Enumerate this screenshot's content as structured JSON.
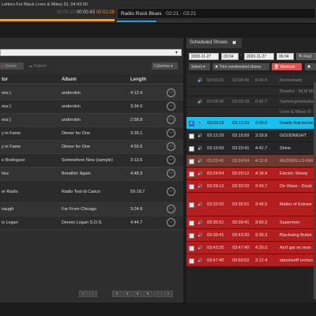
{
  "top": {
    "now_playing": "Letters For Black Lives & Mikey D), 04:43:00",
    "time_elapsed": "00:03:10",
    "time_now": "00:00:43",
    "time_remain": "00:02:26",
    "next_show": "Radio Rock Blues",
    "next_show_time": "02:21 - 03:21",
    "left_progress": 1.0,
    "right_progress": 0.2,
    "colors": {
      "orange": "#f08a24",
      "blue": "#1ea0e0"
    }
  },
  "library": {
    "delete_label": "Delete",
    "publish_label": "Publish",
    "columns_label": "Columns",
    "headers": {
      "creator": "tor",
      "album": "Album",
      "length": "Length"
    },
    "rows": [
      {
        "creator": "ess:)",
        "album": "underskin",
        "length": "4:12.4"
      },
      {
        "creator": "ess:)",
        "album": "underskin",
        "length": "3:34.0"
      },
      {
        "creator": "ess:)",
        "album": "underskin",
        "length": "2:58.8"
      },
      {
        "creator": "y in Fame",
        "album": "Dinner for One",
        "length": "3:39.1"
      },
      {
        "creator": "y in Fame",
        "album": "Dinner for One",
        "length": "4:59.6"
      },
      {
        "creator": "e Rodeguez",
        "album": "Somewhere New (sample)",
        "length": "3:13.6"
      },
      {
        "creator": "hes",
        "album": "Breathin' Again",
        "length": "4:48.3"
      },
      {
        "creator": "er Radio",
        "album": "Radio Test di Carico",
        "length": "59:18.7"
      },
      {
        "creator": "naugh",
        "album": "Far From Chicago",
        "length": "3:24.8"
      },
      {
        "creator": "is Logan",
        "album": "Dennis Logan S.O.S.",
        "length": "4:44.7"
      }
    ],
    "pager": [
      "«",
      "‹",
      "2",
      "3",
      "4",
      "5",
      "›",
      "»"
    ]
  },
  "scheduled": {
    "tab_label": "Scheduled Shows",
    "date_from": "2020-11-27",
    "time_from": "03:04",
    "date_to": "2020-11-27",
    "time_to": "06:04",
    "find_label": "Find",
    "select_label": "Select",
    "trim_label": "Trim overbooked shows",
    "remove_label": "Remove",
    "rows": [
      {
        "start": "03:00:31",
        "end": "03:04:36",
        "len": "0:04:4",
        "title": "Rocksteady",
        "style": "past",
        "checked": false,
        "cb": false
      },
      {
        "start": "",
        "end": "",
        "len": "",
        "title": "Breathe - BLM Mi",
        "style": "past",
        "checked": false,
        "cb": false
      },
      {
        "start": "03:04:36",
        "end": "03:09:18",
        "len": "0:42.7",
        "title": "Spinningmerkaba",
        "style": "past",
        "checked": false,
        "cb": false
      },
      {
        "start": "",
        "end": "",
        "len": "",
        "title": "Lives & Mikey D",
        "style": "past",
        "checked": false,
        "cb": false
      },
      {
        "start": "03:09:19",
        "end": "03:12:29",
        "len": "3:09.6",
        "title": "Roads that burne",
        "style": "current",
        "checked": true,
        "cb": true
      },
      {
        "start": "03:12:29",
        "end": "03:15:59",
        "len": "3:29.8",
        "title": "GOODNIGHT",
        "style": "normal",
        "checked": false,
        "cb": true
      },
      {
        "start": "03:15:59",
        "end": "03:20:41",
        "len": "4:42.7",
        "title": "Shine",
        "style": "normal",
        "checked": false,
        "cb": true
      },
      {
        "start": "03:20:41",
        "end": "03:24:54",
        "len": "4:12.8",
        "title": "MUDSKILLS-RAI",
        "style": "overbook-dark",
        "checked": false,
        "cb": true
      },
      {
        "start": "03:24:54",
        "end": "03:29:12",
        "len": "4:18.4",
        "title": "Electric Sheep",
        "style": "overbook",
        "checked": false,
        "cb": true
      },
      {
        "start": "03:29:12",
        "end": "03:32:02",
        "len": "2:49.7",
        "title": "On Wave - Doub",
        "style": "overbook",
        "checked": false,
        "cb": true
      },
      {
        "start": "03:32:02",
        "end": "03:35:51",
        "len": "3:48.5",
        "title": "Matter of Extraor",
        "style": "overbook",
        "checked": false,
        "cb": true
      },
      {
        "start": "03:35:51",
        "end": "03:39:41",
        "len": "3:50.3",
        "title": "Supermen",
        "style": "overbook",
        "checked": false,
        "cb": true
      },
      {
        "start": "03:39:41",
        "end": "03:43:20",
        "len": "3:39.3",
        "title": "Blackwing Butter",
        "style": "overbook",
        "checked": false,
        "cb": true
      },
      {
        "start": "03:43:20",
        "end": "03:47:40",
        "len": "4:20.0",
        "title": "Ain't got no mon",
        "style": "overbook",
        "checked": false,
        "cb": true
      },
      {
        "start": "03:47:40",
        "end": "03:50:52",
        "len": "3:12.4",
        "title": "starsheriff orches",
        "style": "overbook",
        "checked": false,
        "cb": true
      }
    ]
  }
}
